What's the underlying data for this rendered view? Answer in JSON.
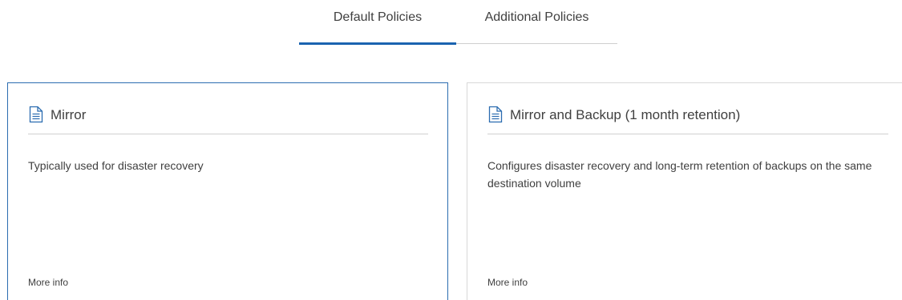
{
  "tabs": {
    "default_label": "Default Policies",
    "additional_label": "Additional Policies"
  },
  "cards": [
    {
      "title": "Mirror",
      "description": "Typically used for disaster recovery",
      "more_info": "More info",
      "icon": "document-icon"
    },
    {
      "title": "Mirror and Backup (1 month retention)",
      "description": "Configures disaster recovery and long-term retention of backups on the same destination volume",
      "more_info": "More info",
      "icon": "document-icon"
    }
  ],
  "colors": {
    "accent": "#1a63b0",
    "selected_border": "#2b6cb0",
    "text": "#404040",
    "divider": "#cfcfcf"
  }
}
